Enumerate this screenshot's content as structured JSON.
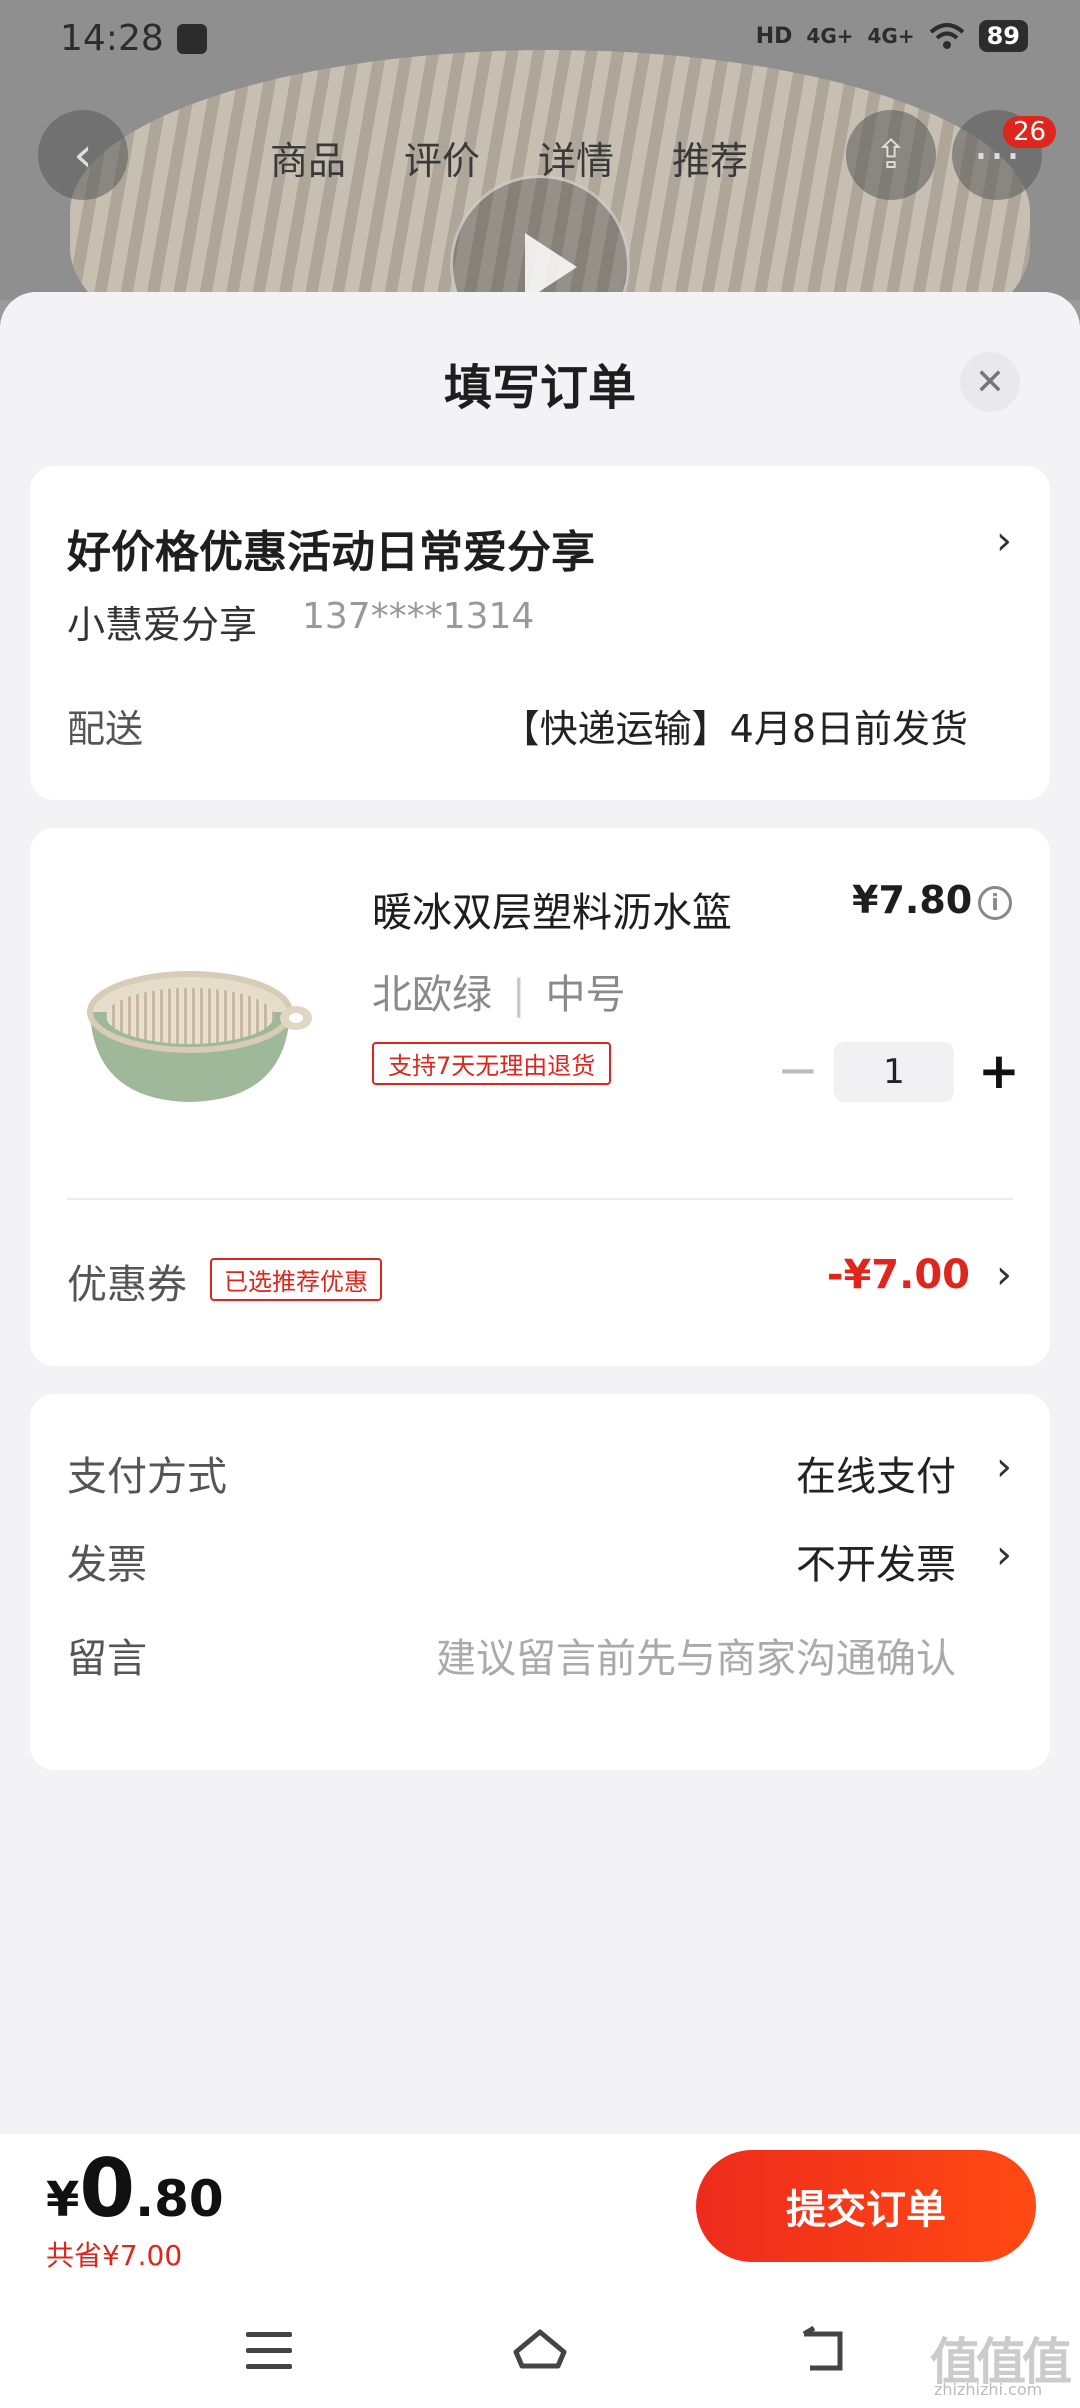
{
  "status_bar": {
    "time": "14:28",
    "network_1": "HD",
    "signal_1": "4G+",
    "signal_2": "4G+",
    "battery": "89"
  },
  "background_page": {
    "tabs": [
      "商品",
      "评价",
      "详情",
      "推荐"
    ],
    "more_badge": "26"
  },
  "sheet": {
    "title": "填写订单",
    "close_icon": "close-icon"
  },
  "address": {
    "title": "好价格优惠活动日常爱分享",
    "name": "小慧爱分享",
    "phone": "137****1314",
    "shipping_label": "配送",
    "shipping_value": "【快递运输】4月8日前发货"
  },
  "product": {
    "name": "暖冰双层塑料沥水篮",
    "price": "¥7.80",
    "color": "北欧绿",
    "separator": "|",
    "size": "中号",
    "return_policy": "支持7天无理由退货",
    "quantity": "1",
    "minus": "−",
    "plus": "+"
  },
  "coupon": {
    "label": "优惠券",
    "tag": "已选推荐优惠",
    "amount": "-¥7.00"
  },
  "payment": {
    "method_label": "支付方式",
    "method_value": "在线支付",
    "invoice_label": "发票",
    "invoice_value": "不开发票",
    "message_label": "留言",
    "message_placeholder": "建议留言前先与商家沟通确认"
  },
  "footer": {
    "currency": "¥",
    "total_int": "0",
    "total_dec": ".80",
    "saved": "共省¥7.00",
    "submit": "提交订单"
  },
  "watermark": {
    "text": "值值值",
    "sub": "zhizhizhi.com"
  },
  "colors": {
    "accent": "#e0251c",
    "button_gradient_start": "#ee2b1d",
    "button_gradient_end": "#ff4a12",
    "sheet_bg": "#f3f3f5"
  }
}
